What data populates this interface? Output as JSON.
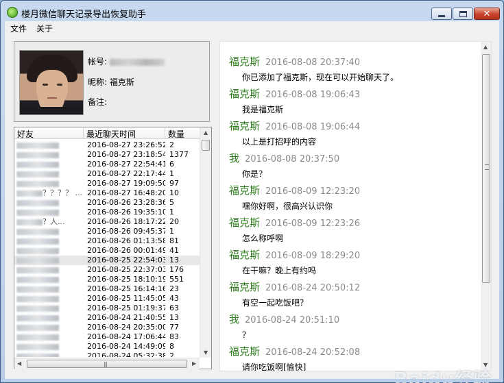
{
  "window": {
    "title": "楼月微信聊天记录导出恢复助手",
    "close_glyph": "✕"
  },
  "menu": {
    "file": "文件",
    "about": "关于"
  },
  "profile": {
    "account_label": "帐号:",
    "nickname_label": "昵称:",
    "nickname_value": "福克斯",
    "remark_label": "备注:"
  },
  "friends": {
    "headers": {
      "name": "好友",
      "time": "最近聊天时间",
      "count": "数量"
    },
    "rows": [
      {
        "name": "",
        "time": "2016-08-27 23:26:52",
        "count": "2"
      },
      {
        "name": "",
        "time": "2016-08-27 23:18:54",
        "count": "1377"
      },
      {
        "name": "",
        "time": "2016-08-27 22:54:41",
        "count": "6"
      },
      {
        "name": "",
        "time": "2016-08-27 22:17:44",
        "count": "1"
      },
      {
        "name": "",
        "time": "2016-08-27 19:09:50",
        "count": "97"
      },
      {
        "name": "？？？？ ...",
        "time": "2016-08-27 16:48:20",
        "count": "10"
      },
      {
        "name": "",
        "time": "2016-08-26 23:28:36",
        "count": "5"
      },
      {
        "name": "",
        "time": "2016-08-26 19:35:10",
        "count": "1"
      },
      {
        "name": "？人...",
        "time": "2016-08-26 18:17:22",
        "count": "20"
      },
      {
        "name": "",
        "time": "2016-08-26 09:45:37",
        "count": "1"
      },
      {
        "name": "",
        "time": "2016-08-26 01:13:58",
        "count": "81"
      },
      {
        "name": "",
        "time": "2016-08-26 00:01:49",
        "count": "41"
      },
      {
        "name": "",
        "time": "2016-08-25 22:54:03",
        "count": "13"
      },
      {
        "name": "",
        "time": "2016-08-25 22:37:03",
        "count": "176"
      },
      {
        "name": "",
        "time": "2016-08-25 18:10:19",
        "count": "551"
      },
      {
        "name": "",
        "time": "2016-08-25 16:14:16",
        "count": "23"
      },
      {
        "name": "",
        "time": "2016-08-25 11:45:05",
        "count": "43"
      },
      {
        "name": "",
        "time": "2016-08-25 01:19:37",
        "count": "63"
      },
      {
        "name": "",
        "time": "2016-08-24 21:40:55",
        "count": "13"
      },
      {
        "name": "",
        "time": "2016-08-24 20:35:00",
        "count": "77"
      },
      {
        "name": "",
        "time": "2016-08-24 17:06:44",
        "count": "83"
      },
      {
        "name": "",
        "time": "2016-08-24 14:49:09",
        "count": "8"
      },
      {
        "name": "",
        "time": "2016-08-24 05:32:38",
        "count": "2"
      }
    ],
    "scroll": {
      "up": "▲",
      "down": "▼",
      "left": "◀",
      "right": "▶",
      "grip": "|||"
    }
  },
  "chat": {
    "messages": [
      {
        "sender": "福克斯",
        "time": "2016-08-08 20:37:40",
        "text": "你已添加了福克斯，现在可以开始聊天了。"
      },
      {
        "sender": "福克斯",
        "time": "2016-08-08 19:06:43",
        "text": "我是福克斯"
      },
      {
        "sender": "福克斯",
        "time": "2016-08-08 19:06:44",
        "text": "以上是打招呼的内容"
      },
      {
        "sender": "我",
        "time": "2016-08-08 20:37:50",
        "text": "你是？"
      },
      {
        "sender": "福克斯",
        "time": "2016-08-09 12:23:20",
        "text": "嘿你好啊，很高兴认识你"
      },
      {
        "sender": "福克斯",
        "time": "2016-08-09 12:23:26",
        "text": "怎么称呼啊"
      },
      {
        "sender": "福克斯",
        "time": "2016-08-09 18:29:20",
        "text": "在干嘛？晚上有约吗"
      },
      {
        "sender": "福克斯",
        "time": "2016-08-24 20:50:12",
        "text": "有空一起吃饭吧？"
      },
      {
        "sender": "我",
        "time": "2016-08-24 20:51:10",
        "text": "？"
      },
      {
        "sender": "福克斯",
        "time": "2016-08-24 20:52:08",
        "text": "请你吃饭啊[愉快]"
      }
    ],
    "scroll": {
      "up": "▲",
      "down": "▼"
    }
  },
  "watermark": "Baidu经验",
  "colors": {
    "sender": "#2e7d1d",
    "timestamp": "#8a8a8a",
    "titlebar": "#c6d9ef"
  }
}
